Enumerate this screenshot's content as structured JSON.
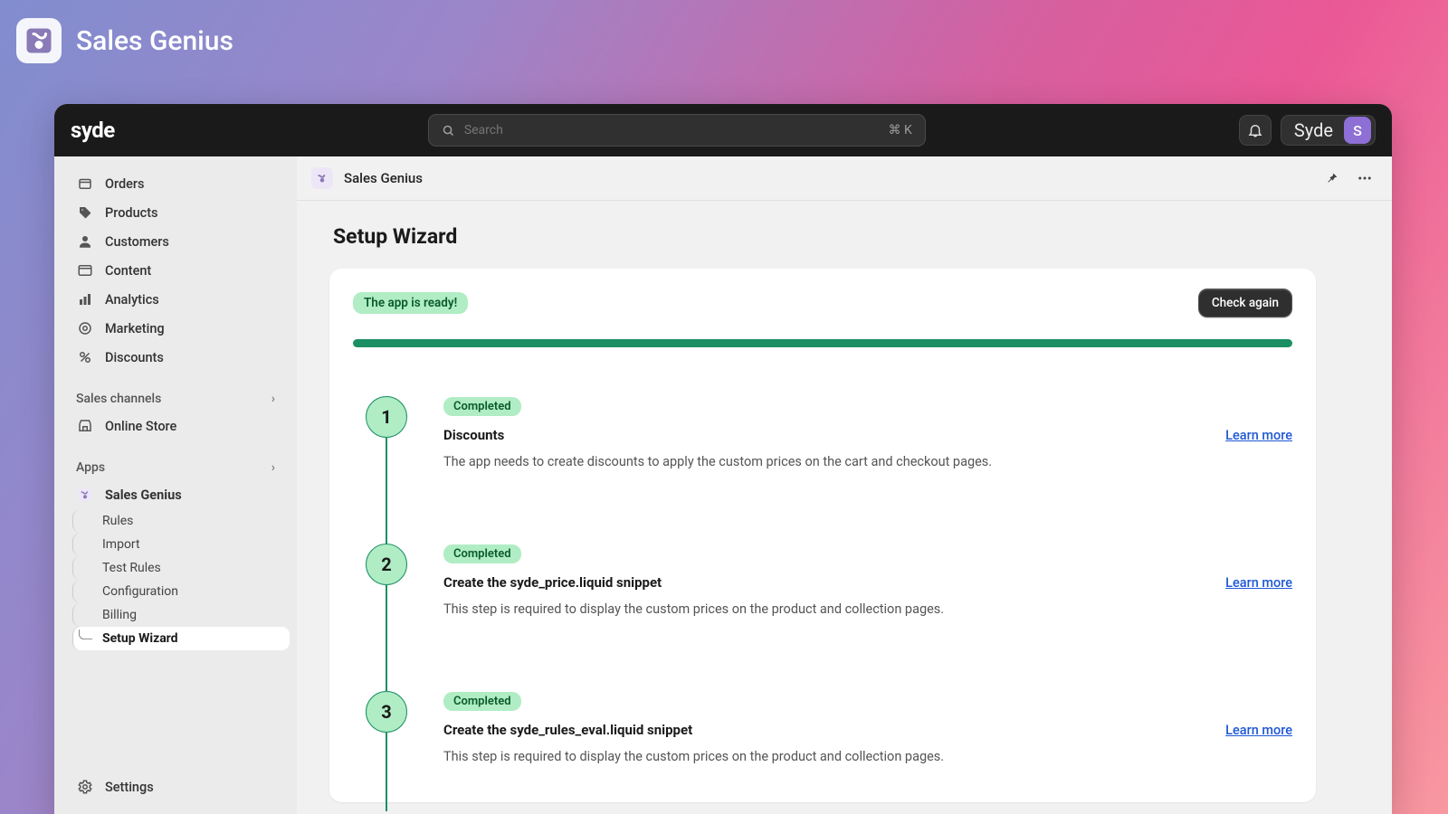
{
  "outer": {
    "title": "Sales Genius"
  },
  "topbar": {
    "brand": "syde",
    "search_placeholder": "Search",
    "search_kbd": "⌘ K",
    "account_name": "Syde",
    "avatar_initial": "S"
  },
  "sidebar": {
    "items": [
      {
        "label": "Orders"
      },
      {
        "label": "Products"
      },
      {
        "label": "Customers"
      },
      {
        "label": "Content"
      },
      {
        "label": "Analytics"
      },
      {
        "label": "Marketing"
      },
      {
        "label": "Discounts"
      }
    ],
    "channels_label": "Sales channels",
    "channels": [
      {
        "label": "Online Store"
      }
    ],
    "apps_label": "Apps",
    "app_name": "Sales Genius",
    "app_subitems": [
      {
        "label": "Rules"
      },
      {
        "label": "Import"
      },
      {
        "label": "Test Rules"
      },
      {
        "label": "Configuration"
      },
      {
        "label": "Billing"
      },
      {
        "label": "Setup Wizard"
      }
    ],
    "settings_label": "Settings"
  },
  "app_header": {
    "name": "Sales Genius"
  },
  "page": {
    "title": "Setup Wizard",
    "ready_badge": "The app is ready!",
    "check_again": "Check again",
    "progress_percent": 100,
    "learn_more_label": "Learn more",
    "steps": [
      {
        "num": "1",
        "status": "Completed",
        "title": "Discounts",
        "desc": "The app needs to create discounts to apply the custom prices on the cart and checkout pages."
      },
      {
        "num": "2",
        "status": "Completed",
        "title": "Create the syde_price.liquid snippet",
        "desc": "This step is required to display the custom prices on the product and collection pages."
      },
      {
        "num": "3",
        "status": "Completed",
        "title": "Create the syde_rules_eval.liquid snippet",
        "desc": "This step is required to display the custom prices on the product and collection pages."
      }
    ]
  }
}
